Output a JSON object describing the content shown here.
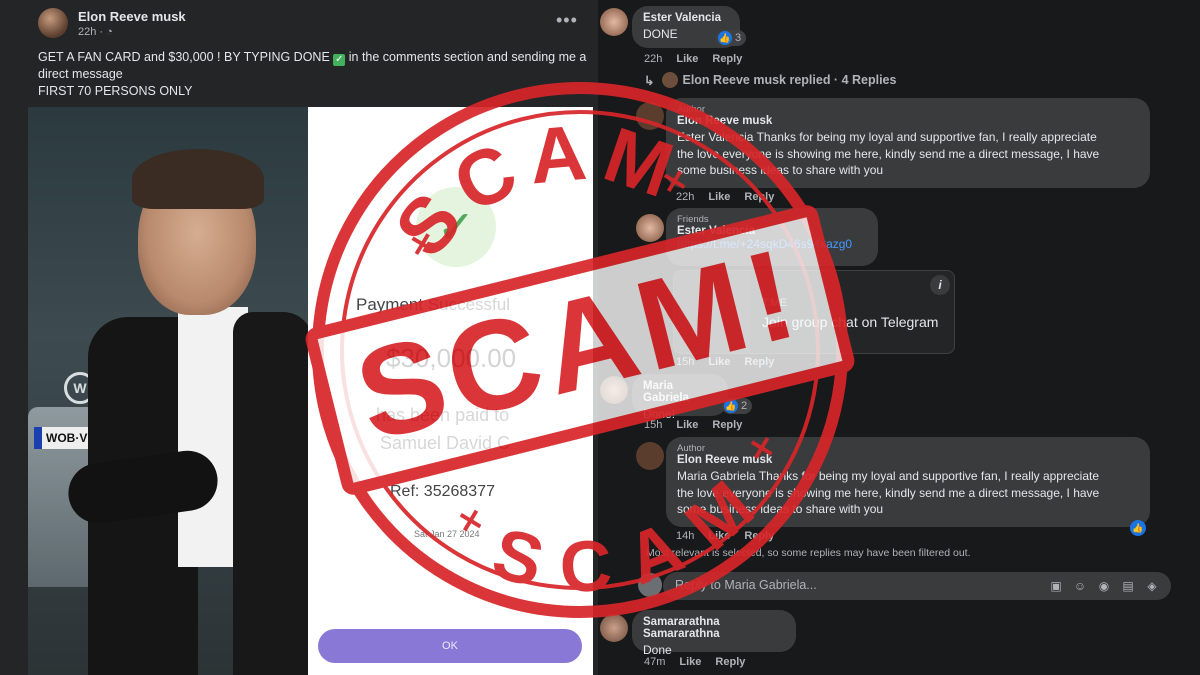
{
  "post": {
    "author": "Elon Reeve musk",
    "time": "22h · ",
    "more": "•••",
    "text_line1": "GET A FAN CARD and $30,000 !  BY TYPING DONE ",
    "check": "✓",
    "text_line1b": " in the comments section and sending me a",
    "text_line2": "direct message",
    "text_line3": "FIRST 70 PERSONS ONLY"
  },
  "image": {
    "vw": "W",
    "plate": "WOB·VH 5",
    "receipt": {
      "check": "✓",
      "title": "Payment Successful",
      "amount": "$30,000.00",
      "line": "has been paid to",
      "name": "Samuel David C",
      "ref": "Ref: 35268377",
      "date": "Sat Jan 27 2024",
      "ok": "OK"
    }
  },
  "comments": [
    {
      "name": "Ester Valencia",
      "text": "DONE",
      "time": "22h",
      "like": "Like",
      "reply": "Reply",
      "reactions": "3"
    },
    {
      "replies_row": "Elon Reeve musk replied · 4 Replies"
    },
    {
      "tag": "Author",
      "name": "Elon Reeve musk",
      "line1": "Ester Valencia Thanks for being my loyal and supportive fan, I really appreciate",
      "line2": "the love everyone is showing me here, kindly send me a direct message, I have",
      "line3": "some business ideas to share with you",
      "time": "22h",
      "like": "Like",
      "reply": "Reply"
    },
    {
      "tag": "Friends",
      "name": "Ester Valencia",
      "link": "https://t.me/+24sqkD46s94xazg0",
      "card_domain": "T.ME",
      "card_title": "Join group chat on Telegram",
      "time": "15h",
      "like": "Like",
      "reply": "Reply"
    },
    {
      "name": "Maria Gabriela",
      "text": "Done!",
      "time": "15h",
      "like": "Like",
      "reply": "Reply",
      "reactions": "2"
    },
    {
      "tag": "Author",
      "name": "Elon Reeve musk",
      "line1": "Maria Gabriela Thanks for being my loyal and supportive fan, I really appreciate",
      "line2": "the love everyone is showing me here, kindly send me a direct message, I have",
      "line3": "some business ideas to share with you",
      "time": "14h",
      "like": "Like",
      "reply": "Reply"
    },
    {
      "name": "Samararathna Samararathna",
      "text": "Done",
      "time": "47m",
      "like": "Like",
      "reply": "Reply"
    }
  ],
  "filter_note": "Most relevant is selected, so some replies may have been filtered out.",
  "reply_box": {
    "placeholder": "Reply to Maria Gabriela..."
  },
  "stamp": {
    "top": "SCAM",
    "center": "SCAM!",
    "bottom": "SCAM",
    "color": "#d7262a"
  },
  "icons": {
    "info": "i",
    "like": "👍",
    "reply_arrow": "↳"
  }
}
